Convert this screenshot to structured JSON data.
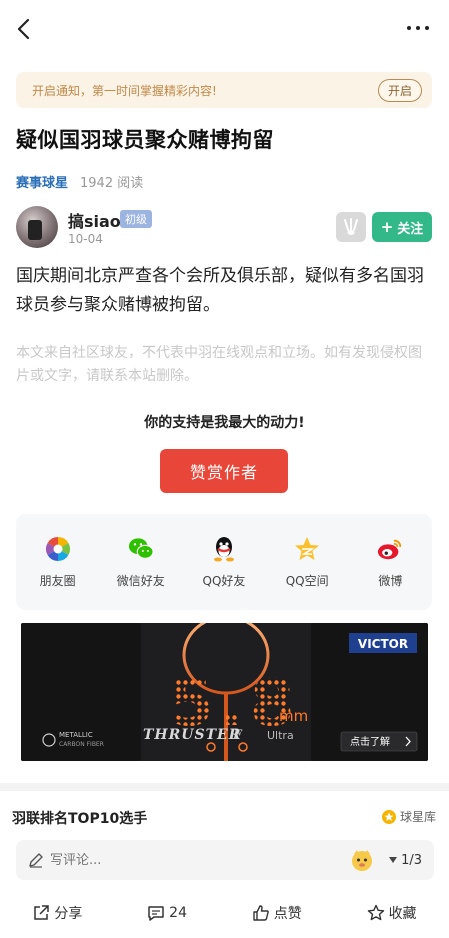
{
  "nav": {
    "back_icon": "chevron-left-icon",
    "more_icon": "more-dots-icon"
  },
  "notice": {
    "text": "开启通知，第一时间掌握精彩内容!",
    "button": "开启"
  },
  "article": {
    "title": "疑似国羽球员聚众赌博拘留",
    "category": "赛事球星",
    "read_count": "1942 阅读",
    "body": "国庆期间北京严查各个会所及俱乐部，疑似有多名国羽球员参与聚众赌博被拘留。",
    "disclaimer": "本文来自社区球友，不代表中羽在线观点和立场。如有发现侵权图片或文字，请联系本站删除。"
  },
  "author": {
    "name": "搞siao",
    "level": "初级",
    "date": "10-04",
    "follow_label": "关注"
  },
  "support": {
    "text": "你的支持是我最大的动力!",
    "reward_label": "赞赏作者"
  },
  "share": [
    {
      "label": "朋友圈",
      "icon": "moments-icon"
    },
    {
      "label": "微信好友",
      "icon": "wechat-icon"
    },
    {
      "label": "QQ好友",
      "icon": "qq-icon"
    },
    {
      "label": "QQ空间",
      "icon": "qzone-icon"
    },
    {
      "label": "微博",
      "icon": "weibo-icon"
    }
  ],
  "ad": {
    "brand": "VICTOR",
    "product": "THRUSTER",
    "product_suffix": "F",
    "variant": "Ultra",
    "big_number": "5.8",
    "unit": "mm",
    "tag": "METALLIC",
    "tag_sub": "CARBON FIBER",
    "cta": "点击了解"
  },
  "ranking": {
    "title": "羽联排名TOP10选手",
    "link": "球星库"
  },
  "comment": {
    "placeholder": "写评论...",
    "page": "1/3"
  },
  "actions": [
    {
      "label": "分享",
      "icon": "share-icon"
    },
    {
      "label": "24",
      "icon": "comment-icon"
    },
    {
      "label": "点赞",
      "icon": "thumb-up-icon"
    },
    {
      "label": "收藏",
      "icon": "star-icon"
    }
  ],
  "colors": {
    "accent_green": "#33b889",
    "reward_red": "#e9463a",
    "link_blue": "#2a6fb8",
    "notice_bg": "#fbf3e6"
  }
}
